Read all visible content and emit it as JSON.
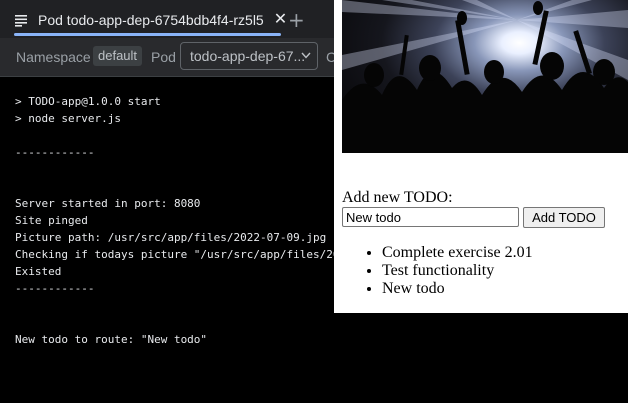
{
  "devtools": {
    "tab": {
      "title": "Pod todo-app-dep-6754bdb4f4-rz5l5",
      "close_glyph": "✕",
      "add_glyph": "+"
    },
    "toolbar": {
      "namespace_label": "Namespace",
      "namespace_value": "default",
      "pod_label": "Pod",
      "pod_select_value": "todo-app-dep-67...",
      "cut_label": "C"
    },
    "log_lines": [
      "> TODO-app@1.0.0 start",
      "> node server.js",
      "",
      "------------",
      "",
      "",
      "Server started in port: 8080",
      "Site pinged",
      "Picture path: /usr/src/app/files/2022-07-09.jpg",
      "Checking if todays picture \"/usr/src/app/files/20",
      "Existed",
      "------------",
      "",
      "",
      "New todo to route: \"New todo\""
    ],
    "colors": {
      "tab_underline": "#8ab4f8",
      "panel_bg": "#000000",
      "tabbar_bg": "#202124"
    }
  },
  "webapp": {
    "hero_image": "concert-crowd-photo",
    "add_title": "Add new TODO:",
    "input_value": "New todo",
    "button_label": "Add TODO",
    "todos": [
      "Complete exercise 2.01",
      "Test functionality",
      "New todo"
    ]
  }
}
